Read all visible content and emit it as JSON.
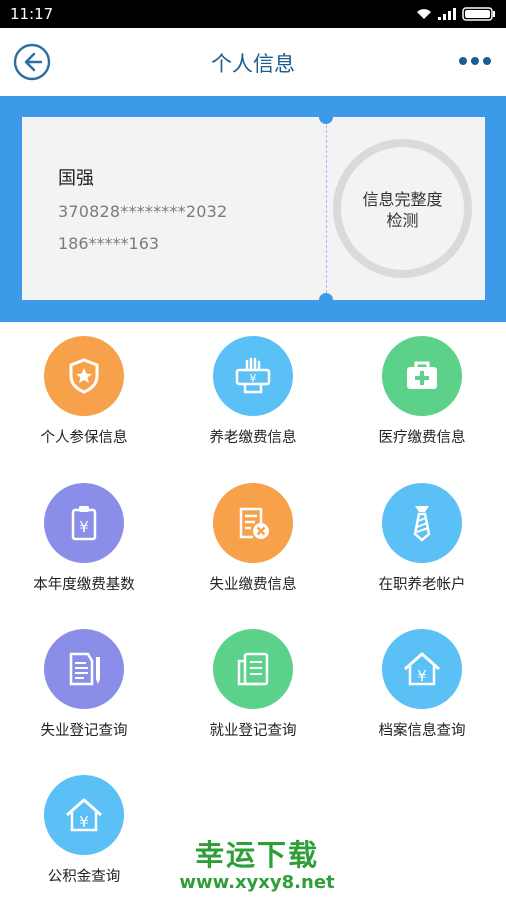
{
  "status_bar": {
    "time": "11:17"
  },
  "header": {
    "title": "个人信息"
  },
  "card": {
    "name": "国强",
    "id_number": "370828********2032",
    "phone": "186*****163",
    "completeness_label": "信息完整度\n检测"
  },
  "menu": [
    {
      "label": "个人参保信息",
      "color": "#f7a14a",
      "icon": "shield-star-icon"
    },
    {
      "label": "养老缴费信息",
      "color": "#5bc0f5",
      "icon": "hand-money-icon"
    },
    {
      "label": "医疗缴费信息",
      "color": "#5cd18a",
      "icon": "medical-kit-icon"
    },
    {
      "label": "本年度缴费基数",
      "color": "#8b8ee8",
      "icon": "clipboard-yen-icon"
    },
    {
      "label": "失业缴费信息",
      "color": "#f7a14a",
      "icon": "document-cancel-icon"
    },
    {
      "label": "在职养老帐户",
      "color": "#5bc0f5",
      "icon": "tie-icon"
    },
    {
      "label": "失业登记查询",
      "color": "#8b8ee8",
      "icon": "document-pen-icon"
    },
    {
      "label": "就业登记查询",
      "color": "#5cd18a",
      "icon": "document-list-icon"
    },
    {
      "label": "档案信息查询",
      "color": "#5bc0f5",
      "icon": "house-yen-icon"
    },
    {
      "label": "公积金查询",
      "color": "#5bc0f5",
      "icon": "house-yen-icon"
    }
  ],
  "watermark": {
    "title": "幸运下载",
    "url": "www.xyxy8.net"
  }
}
